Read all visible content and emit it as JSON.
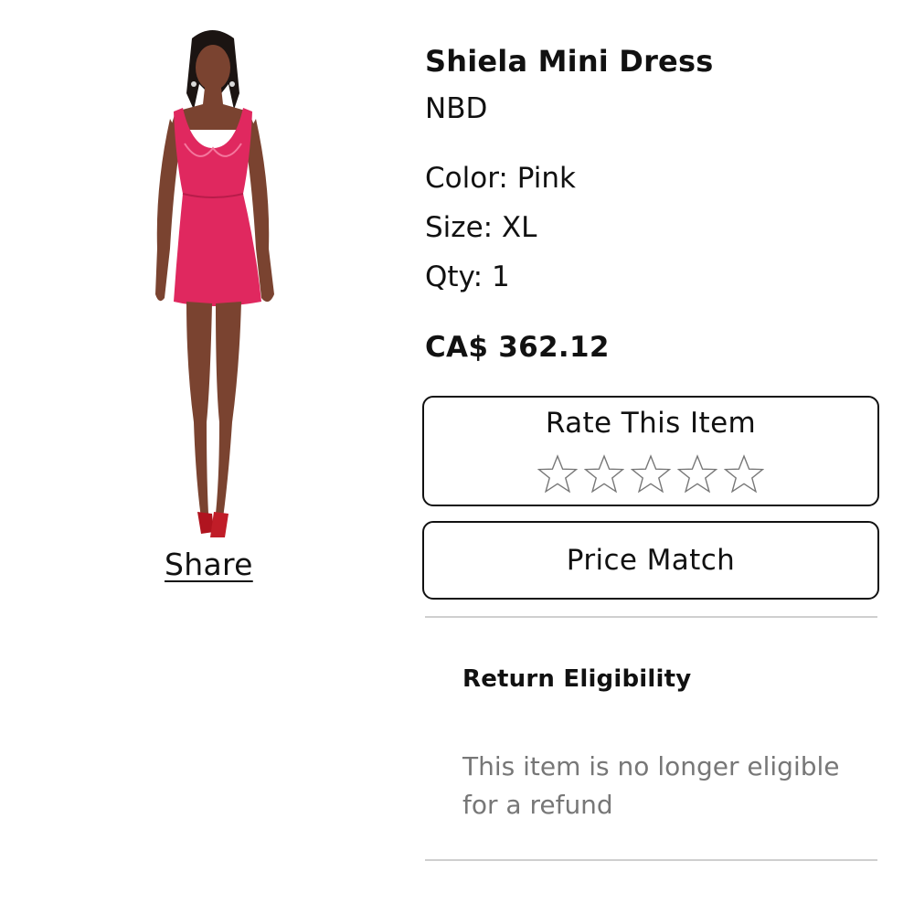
{
  "product": {
    "image_alt": "Model wearing pink mini dress",
    "title": "Shiela Mini Dress",
    "brand": "NBD",
    "color": "Color: Pink",
    "size": "Size: XL",
    "qty": "Qty: 1",
    "price": "CA$ 362.12"
  },
  "share_label": "Share",
  "rating": {
    "title": "Rate This Item",
    "max_stars": 5,
    "current": 0,
    "star_icon": "star-outline-icon"
  },
  "price_match_label": "Price Match",
  "return": {
    "title": "Return Eligibility",
    "text": "This item is no longer eligible for a refund"
  },
  "colors": {
    "dress": "#e0285f",
    "text": "#111111",
    "muted": "#777777",
    "divider": "#cfcfcf"
  }
}
